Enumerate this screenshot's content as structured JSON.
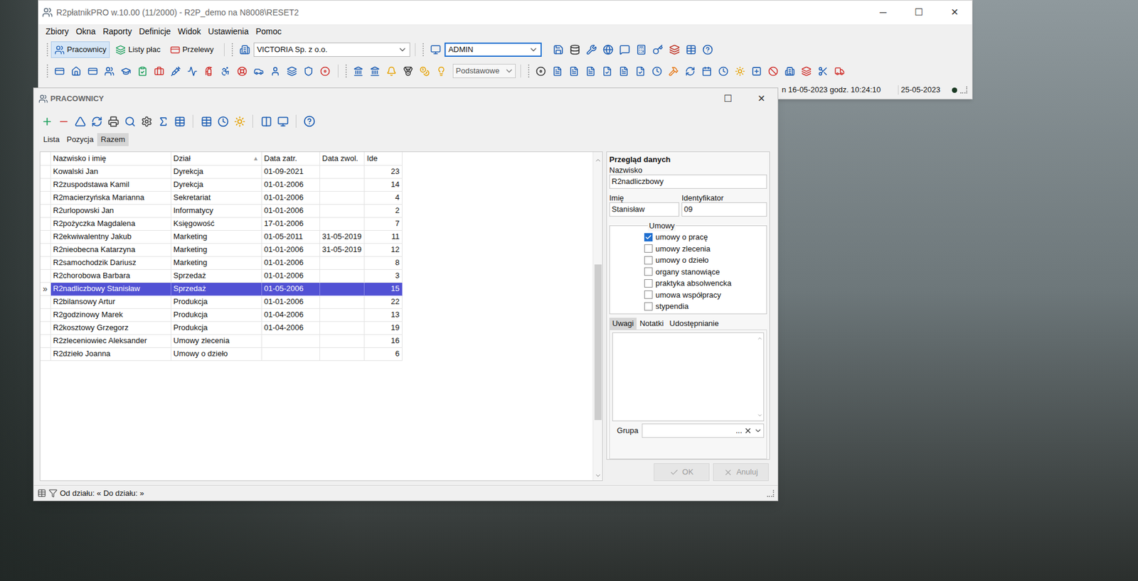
{
  "main_window": {
    "title": "R2płatnikPRO w.10.00 (11/2000) - R2P_demo na N8008\\RESET2",
    "controls": [
      "─",
      "☐",
      "✕"
    ]
  },
  "menu": [
    "Zbiory",
    "Okna",
    "Raporty",
    "Definicje",
    "Widok",
    "Ustawienia",
    "Pomoc"
  ],
  "modules": [
    {
      "label": "Pracownicy",
      "selected": true
    },
    {
      "label": "Listy płac",
      "selected": false
    },
    {
      "label": "Przelewy",
      "selected": false
    }
  ],
  "company_select": {
    "value": "VICTORIA Sp. z o.o."
  },
  "user_select": {
    "value": "ADMIN",
    "focused": true
  },
  "view_select": {
    "value": "Podstawowe"
  },
  "status": {
    "session": "n 16-05-2023 godz. 10:24:10",
    "date": "25-05-2023"
  },
  "child_window": {
    "title": "PRACOWNICY",
    "controls": [
      "☐",
      "✕"
    ]
  },
  "view_tabs": [
    {
      "label": "Lista",
      "selected": false
    },
    {
      "label": "Pozycja",
      "selected": false
    },
    {
      "label": "Razem",
      "selected": true
    }
  ],
  "table": {
    "columns": [
      {
        "label": "Nazwisko i imię",
        "sort_glyph": ""
      },
      {
        "label": "Dział",
        "sort_glyph": "▲"
      },
      {
        "label": "Data zatr.",
        "sort_glyph": ""
      },
      {
        "label": "Data zwol.",
        "sort_glyph": ""
      },
      {
        "label": "Ide",
        "sort_glyph": ""
      }
    ],
    "current_marker": "»",
    "rows": [
      {
        "cells": [
          "Kowalski Jan",
          "Dyrekcja",
          "01-09-2021",
          "",
          "23"
        ],
        "selected": false
      },
      {
        "cells": [
          "R2zuspodstawa Kamil",
          "Dyrekcja",
          "01-01-2006",
          "",
          "14"
        ],
        "selected": false
      },
      {
        "cells": [
          "R2macierzyńska Marianna",
          "Sekretariat",
          "01-01-2006",
          "",
          "4"
        ],
        "selected": false
      },
      {
        "cells": [
          "R2urlopowski Jan",
          "Informatycy",
          "01-01-2006",
          "",
          "2"
        ],
        "selected": false
      },
      {
        "cells": [
          "R2pożyczka Magdalena",
          "Księgowość",
          "17-01-2006",
          "",
          "7"
        ],
        "selected": false
      },
      {
        "cells": [
          "R2ekwiwalentny Jakub",
          "Marketing",
          "01-05-2011",
          "31-05-2019",
          "11"
        ],
        "selected": false
      },
      {
        "cells": [
          "R2nieobecna Katarzyna",
          "Marketing",
          "01-01-2006",
          "31-05-2019",
          "12"
        ],
        "selected": false
      },
      {
        "cells": [
          "R2samochodzik Dariusz",
          "Marketing",
          "01-01-2006",
          "",
          "8"
        ],
        "selected": false
      },
      {
        "cells": [
          "R2chorobowa Barbara",
          "Sprzedaż",
          "01-01-2006",
          "",
          "3"
        ],
        "selected": false
      },
      {
        "cells": [
          "R2nadliczbowy Stanisław",
          "Sprzedaż",
          "01-05-2006",
          "",
          "15"
        ],
        "selected": true
      },
      {
        "cells": [
          "R2bilansowy Artur",
          "Produkcja",
          "01-01-2006",
          "",
          "22"
        ],
        "selected": false
      },
      {
        "cells": [
          "R2godzinowy Marek",
          "Produkcja",
          "01-04-2006",
          "",
          "13"
        ],
        "selected": false
      },
      {
        "cells": [
          "R2kosztowy Grzegorz",
          "Produkcja",
          "01-04-2006",
          "",
          "19"
        ],
        "selected": false
      },
      {
        "cells": [
          "R2zleceniowiec Aleksander",
          "Umowy zlecenia",
          "",
          "",
          "16"
        ],
        "selected": false
      },
      {
        "cells": [
          "R2dzieło Joanna",
          "Umowy o dzieło",
          "",
          "",
          "6"
        ],
        "selected": false
      }
    ],
    "scroll": {
      "offset": 0.31,
      "size": 0.5
    }
  },
  "details": {
    "heading": "Przegląd danych",
    "surname": {
      "label": "Nazwisko",
      "value": "R2nadliczbowy"
    },
    "name": {
      "label": "Imię",
      "value": "Stanisław"
    },
    "identifier": {
      "label": "Identyfikator",
      "value": "09"
    },
    "contracts": {
      "label": "Umowy",
      "items": [
        {
          "label": "umowy o pracę",
          "checked": true
        },
        {
          "label": "umowy zlecenia",
          "checked": false
        },
        {
          "label": "umowy o dzieło",
          "checked": false
        },
        {
          "label": "organy stanowiące",
          "checked": false
        },
        {
          "label": "praktyka absolwencka",
          "checked": false
        },
        {
          "label": "umowa współpracy",
          "checked": false
        },
        {
          "label": "stypendia",
          "checked": false
        }
      ]
    },
    "tabs": [
      {
        "label": "Uwagi",
        "selected": true
      },
      {
        "label": "Notatki",
        "selected": false
      },
      {
        "label": "Udostępnianie",
        "selected": false
      }
    ],
    "notes": "",
    "group": {
      "label": "Grupa",
      "value": "",
      "browse_glyph": "..."
    }
  },
  "buttons": [
    {
      "label": "OK",
      "disabled": true
    },
    {
      "label": "Anuluj",
      "disabled": true
    }
  ],
  "footer": {
    "from": "Od działu: «",
    "to": "Do działu: »"
  }
}
